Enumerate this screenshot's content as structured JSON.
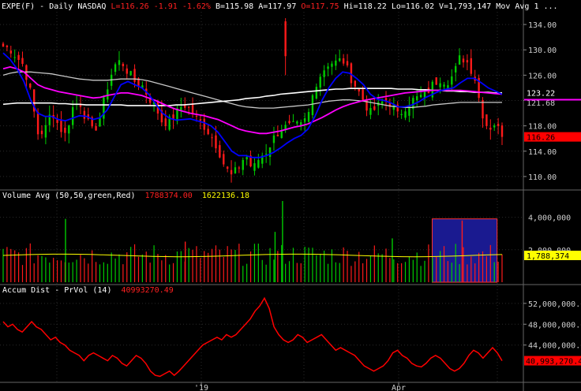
{
  "header": {
    "symbol": "EXPE(F) - Daily  NASDAQ",
    "last": "L=116.26",
    "change": "-1.91",
    "change_pct": "-1.62%",
    "bid": "B=115.98",
    "ask": "A=117.97",
    "open": "O=117.75",
    "high": "Hi=118.22",
    "low": "Lo=116.02",
    "volume": "V=1,793,147",
    "ma_label": "Mov Avg 1",
    "ellipsis": "..."
  },
  "colors": {
    "up": "#00cc00",
    "down": "#ff1a1a",
    "ma_fast": "#0000ff",
    "ma_mid": "#ff00ff",
    "ma_slow": "#c8c8c8",
    "ma_long": "#ffffff",
    "vol_avg": "#ffff00",
    "accum": "#ff0000",
    "grid": "#2a2a2a",
    "text": "#cfcfcf"
  },
  "volume_header": {
    "label": "Volume Avg (50,50,green,Red)",
    "value1": "1788374.00",
    "value2": "1622136.18"
  },
  "accum_header": {
    "label": "Accum Dist - PrVol (14)",
    "value": "40993270.49"
  },
  "chart_data": [
    {
      "type": "candlestick",
      "title": "EXPE(F) - Daily NASDAQ",
      "x_ticks": [
        "'19",
        "Apr"
      ],
      "y_ticks": [
        "134.00",
        "130.00",
        "126.00",
        "122.00",
        "118.00",
        "114.00",
        "110.00"
      ],
      "ylim": [
        108,
        136
      ],
      "price_labels": [
        {
          "value": 123.22,
          "text": "123.22",
          "bg": "#000000",
          "fg": "#ffffff"
        },
        {
          "value": 121.68,
          "text": "121.68",
          "bg": "#000000",
          "fg": "#c8c8c8"
        },
        {
          "value": 116.26,
          "text": "116.26",
          "bg": "#ff0000",
          "fg": "#000000"
        }
      ],
      "close_anchors": [
        130.5,
        130.2,
        128.8,
        127.5,
        123.0,
        116.8,
        117.2,
        120.5,
        118.0,
        116.5,
        120.8,
        122.0,
        119.0,
        116.8,
        119.5,
        124.0,
        127.5,
        128.3,
        126.5,
        125.0,
        124.5,
        122.5,
        121.0,
        118.5,
        118.8,
        120.0,
        121.5,
        120.5,
        119.0,
        118.0,
        116.5,
        114.5,
        111.5,
        110.0,
        111.5,
        113.5,
        111.0,
        113.0,
        114.0,
        116.0,
        117.5,
        117.8,
        118.0,
        118.0,
        119.5,
        124.5,
        126.5,
        128.0,
        128.0,
        128.5,
        126.0,
        124.0,
        122.0,
        120.0,
        121.0,
        122.0,
        121.5,
        119.5,
        121.0,
        122.0,
        122.5,
        123.0,
        124.5,
        125.5,
        125.0,
        126.0,
        129.0,
        128.0,
        126.0,
        120.5,
        117.5,
        118.5,
        116.26
      ],
      "ma_fast": [
        129.5,
        128.5,
        127.0,
        125.0,
        122.0,
        120.0,
        119.5,
        119.5,
        119.0,
        118.8,
        119.2,
        119.6,
        119.5,
        119.0,
        119.3,
        120.5,
        122.5,
        124.5,
        125.0,
        124.5,
        124.0,
        123.0,
        121.5,
        120.0,
        119.2,
        118.9,
        119.0,
        119.1,
        118.8,
        118.5,
        118.0,
        117.0,
        115.5,
        114.0,
        113.3,
        113.3,
        113.0,
        113.0,
        113.3,
        113.8,
        114.5,
        115.3,
        116.0,
        116.5,
        117.5,
        119.5,
        122.0,
        124.0,
        125.5,
        126.5,
        126.3,
        125.5,
        124.5,
        123.0,
        122.2,
        122.0,
        121.6,
        121.0,
        121.0,
        121.3,
        121.8,
        122.5,
        123.0,
        123.5,
        123.8,
        124.0,
        124.8,
        125.5,
        125.5,
        124.8,
        124.0,
        123.5,
        123.0
      ],
      "ma_mid": [
        127.0,
        127.3,
        127.0,
        126.5,
        125.5,
        124.5,
        124.0,
        123.7,
        123.4,
        123.2,
        123.0,
        122.8,
        122.6,
        122.4,
        122.5,
        122.8,
        123.0,
        123.2,
        123.2,
        123.0,
        122.8,
        122.4,
        122.0,
        121.5,
        121.0,
        120.6,
        120.3,
        120.0,
        119.8,
        119.6,
        119.3,
        119.0,
        118.5,
        118.0,
        117.5,
        117.2,
        117.0,
        116.8,
        116.8,
        117.0,
        117.2,
        117.5,
        117.8,
        118.0,
        118.3,
        118.8,
        119.3,
        119.9,
        120.5,
        121.0,
        121.4,
        121.7,
        122.0,
        122.2,
        122.4,
        122.6,
        122.8,
        123.0,
        123.2,
        123.3,
        123.4,
        123.5,
        123.6,
        123.6,
        123.6,
        123.6,
        123.6,
        123.5,
        123.4,
        123.3,
        123.2,
        123.1,
        123.0
      ],
      "ma_slow": [
        126.0,
        126.3,
        126.5,
        126.5,
        126.5,
        126.4,
        126.3,
        126.2,
        126.0,
        125.8,
        125.6,
        125.4,
        125.3,
        125.2,
        125.2,
        125.2,
        125.3,
        125.4,
        125.4,
        125.4,
        125.3,
        125.1,
        124.8,
        124.5,
        124.2,
        123.9,
        123.6,
        123.3,
        123.0,
        122.7,
        122.4,
        122.1,
        121.8,
        121.5,
        121.2,
        121.0,
        120.9,
        120.8,
        120.8,
        120.8,
        120.9,
        121.0,
        121.1,
        121.2,
        121.3,
        121.5,
        121.7,
        121.9,
        122.0,
        122.1,
        122.1,
        122.0,
        121.9,
        121.7,
        121.5,
        121.3,
        121.1,
        121.0,
        120.9,
        120.9,
        121.0,
        121.1,
        121.3,
        121.4,
        121.5,
        121.6,
        121.7,
        121.7,
        121.7,
        121.7,
        121.7,
        121.7,
        121.7
      ],
      "ma_long": [
        121.4,
        121.5,
        121.6,
        121.6,
        121.6,
        121.6,
        121.6,
        121.6,
        121.5,
        121.5,
        121.4,
        121.4,
        121.3,
        121.3,
        121.3,
        121.3,
        121.3,
        121.3,
        121.2,
        121.2,
        121.2,
        121.2,
        121.2,
        121.2,
        121.2,
        121.3,
        121.3,
        121.4,
        121.5,
        121.6,
        121.7,
        121.8,
        121.9,
        122.0,
        122.1,
        122.3,
        122.4,
        122.5,
        122.7,
        122.8,
        123.0,
        123.1,
        123.2,
        123.3,
        123.4,
        123.5,
        123.6,
        123.7,
        123.8,
        123.8,
        123.9,
        123.9,
        123.9,
        123.9,
        123.9,
        123.9,
        123.9,
        123.8,
        123.8,
        123.8,
        123.7,
        123.7,
        123.6,
        123.6,
        123.5,
        123.5,
        123.4,
        123.4,
        123.3,
        123.3,
        123.3,
        123.2,
        123.22
      ]
    },
    {
      "type": "bar",
      "title": "Volume Avg (50,50,green,Red)",
      "y_ticks": [
        "4,000,000",
        "2,000,000"
      ],
      "ylim": [
        0,
        5000000
      ],
      "vol_avg_label": "1,788,374",
      "spikes": [
        {
          "pos": 0.125,
          "value": 3900000,
          "up": true
        },
        {
          "pos": 0.56,
          "value": 5000000,
          "up": true
        },
        {
          "pos": 0.545,
          "value": 3100000,
          "up": true
        },
        {
          "pos": 0.365,
          "value": 2500000,
          "up": false
        },
        {
          "pos": 0.92,
          "value": 3800000,
          "up": false
        },
        {
          "pos": 0.78,
          "value": 2700000,
          "up": true
        }
      ],
      "avg_level": 1650000,
      "highlight_box": {
        "from": 0.86,
        "to": 0.99,
        "top": 3900000,
        "color": "#1a1a90"
      }
    },
    {
      "type": "line",
      "title": "Accum Dist - PrVol (14)",
      "y_ticks": [
        "52,000,000.00",
        "48,000,000.00",
        "44,000,000.00"
      ],
      "ylim": [
        37000000,
        55000000
      ],
      "last_label": "40,993,270.49",
      "values": [
        48.5,
        47.5,
        48.0,
        47.0,
        46.5,
        47.5,
        48.5,
        47.5,
        47.0,
        46.0,
        45.0,
        45.5,
        44.5,
        44.0,
        43.0,
        42.5,
        42.0,
        41.0,
        42.0,
        42.5,
        42.0,
        41.5,
        41.0,
        42.0,
        41.5,
        40.5,
        40.0,
        41.0,
        42.0,
        41.5,
        40.5,
        39.0,
        38.2,
        38.0,
        38.5,
        39.0,
        38.2,
        39.0,
        40.0,
        41.0,
        42.0,
        43.0,
        44.0,
        44.5,
        45.0,
        45.5,
        45.0,
        46.0,
        45.5,
        46.0,
        47.0,
        48.0,
        49.0,
        50.5,
        51.5,
        53.0,
        51.0,
        47.5,
        46.0,
        45.0,
        44.5,
        45.0,
        46.0,
        45.5,
        44.5,
        45.0,
        45.5,
        46.0,
        45.0,
        44.0,
        43.0,
        43.5,
        43.0,
        42.5,
        42.0,
        41.0,
        40.0,
        39.5,
        39.0,
        39.5,
        40.0,
        41.0,
        42.5,
        43.0,
        42.0,
        41.5,
        40.5,
        40.0,
        39.8,
        40.5,
        41.5,
        42.0,
        41.5,
        40.5,
        39.5,
        39.0,
        39.5,
        40.5,
        42.0,
        43.0,
        42.5,
        41.5,
        42.5,
        43.5,
        42.5,
        41.0
      ]
    }
  ]
}
